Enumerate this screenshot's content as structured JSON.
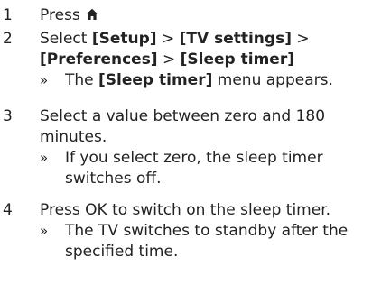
{
  "steps": [
    {
      "number": "1",
      "press_label": "Press",
      "icon": "home-icon"
    },
    {
      "number": "2",
      "select_label": "Select",
      "setup": "[Setup]",
      "separator": ">",
      "tv_settings": "[TV settings]",
      "preferences": "[Preferences]",
      "sleep_timer": "[Sleep timer]",
      "bullet": "»",
      "result_the": "The",
      "result_menu": "[Sleep timer]",
      "result_rest": "menu appears."
    },
    {
      "number": "3",
      "line1": "Select a value between zero and 180",
      "line2": "minutes.",
      "bullet": "»",
      "note_line1": "If you select zero, the sleep timer",
      "note_line2": "switches off."
    },
    {
      "number": "4",
      "line1": "Press OK  to switch on the sleep timer.",
      "bullet": "»",
      "note_line1": "The TV switches to standby after the",
      "note_line2": "specified time."
    }
  ]
}
